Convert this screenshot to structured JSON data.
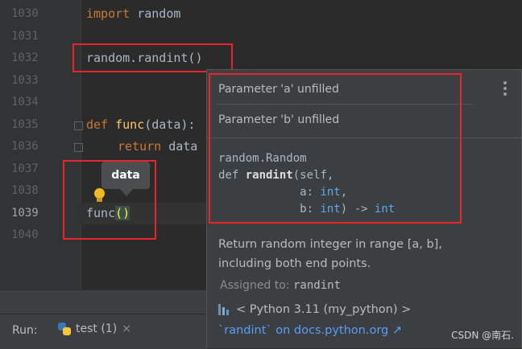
{
  "editor": {
    "line_numbers": [
      "1030",
      "1031",
      "1032",
      "1033",
      "1034",
      "1035",
      "1036",
      "1037",
      "1038",
      "1039",
      "1040"
    ],
    "current_line": "1039",
    "code": {
      "l1030_kw": "import",
      "l1030_rest": " random",
      "l1032": "random.randint()",
      "l1035_kw": "def",
      "l1035_fn": "func",
      "l1035_rest": "(data):",
      "l1036_kw": "return",
      "l1036_rest": " data",
      "l1039_name": "func",
      "l1039_parens": "()"
    }
  },
  "tooltip": {
    "text": "data"
  },
  "popup": {
    "param_a": "Parameter 'a' unfilled",
    "param_b": "Parameter 'b' unfilled",
    "signature": {
      "line1": "random.Random",
      "def_kw": "def ",
      "func_name": "randint",
      "open": "(self,",
      "param_a": "a",
      "type_a": "int",
      "param_b": "b",
      "type_b": "int",
      "arrow": ") -> ",
      "ret": "int"
    },
    "doc": "Return random integer in range [a, b], including both end points.",
    "assigned_label": "Assigned to:",
    "assigned_value": "randint",
    "python_version": "< Python 3.11 (my_python) >",
    "docs_link": "`randint` on docs.python.org ↗"
  },
  "run_panel": {
    "label": "Run:",
    "tab_label": "test (1)",
    "close_glyph": "×"
  },
  "watermark": "CSDN @南石.",
  "colors": {
    "annotation_red": "#e8262a",
    "keyword": "#cc7832",
    "function": "#ffc66d",
    "link": "#589df6"
  }
}
